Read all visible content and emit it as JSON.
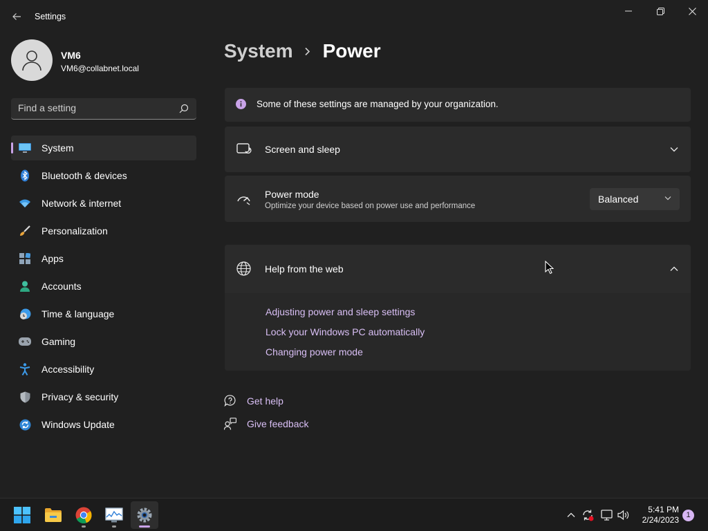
{
  "window": {
    "title": "Settings",
    "accent_color": "#c9a3e8",
    "link_color": "#d9bff5"
  },
  "profile": {
    "name": "VM6",
    "email": "VM6@collabnet.local"
  },
  "search": {
    "placeholder": "Find a setting"
  },
  "sidebar": {
    "items": [
      {
        "label": "System",
        "icon": "monitor-icon",
        "active": true
      },
      {
        "label": "Bluetooth & devices",
        "icon": "bluetooth-icon"
      },
      {
        "label": "Network & internet",
        "icon": "wifi-icon"
      },
      {
        "label": "Personalization",
        "icon": "brush-icon"
      },
      {
        "label": "Apps",
        "icon": "apps-icon"
      },
      {
        "label": "Accounts",
        "icon": "person-icon"
      },
      {
        "label": "Time & language",
        "icon": "clock-globe-icon"
      },
      {
        "label": "Gaming",
        "icon": "gamepad-icon"
      },
      {
        "label": "Accessibility",
        "icon": "accessibility-icon"
      },
      {
        "label": "Privacy & security",
        "icon": "shield-icon"
      },
      {
        "label": "Windows Update",
        "icon": "update-icon"
      }
    ]
  },
  "header": {
    "parent": "System",
    "current": "Power"
  },
  "info": {
    "text": "Some of these settings are managed by your organization."
  },
  "screen_sleep": {
    "title": "Screen and sleep"
  },
  "power_mode": {
    "title": "Power mode",
    "subtitle": "Optimize your device based on power use and performance",
    "selected": "Balanced"
  },
  "help": {
    "title": "Help from the web",
    "links": [
      "Adjusting power and sleep settings",
      "Lock your Windows PC automatically",
      "Changing power mode"
    ]
  },
  "footer_links": {
    "get_help": "Get help",
    "give_feedback": "Give feedback"
  },
  "taskbar": {
    "apps": [
      "start-icon",
      "file-explorer-icon",
      "chrome-icon",
      "resource-monitor-icon",
      "settings-icon"
    ],
    "time": "5:41 PM",
    "date": "2/24/2023",
    "notification_count": "1"
  }
}
